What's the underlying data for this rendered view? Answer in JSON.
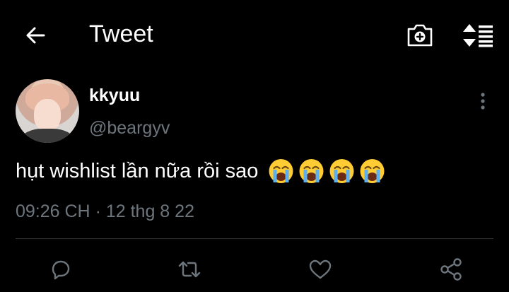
{
  "header": {
    "back_icon": "arrow-left-icon",
    "title": "Tweet",
    "camera_icon": "camera-plus-icon",
    "sort_icon": "sort-icon"
  },
  "tweet": {
    "display_name": "kkyuu",
    "handle": "@beargyv",
    "text": "hụt wishlist lần nữa rồi sao",
    "emojis": [
      "loudly-crying-face",
      "loudly-crying-face",
      "loudly-crying-face",
      "loudly-crying-face"
    ],
    "time": "09:26 CH",
    "separator": "·",
    "date": "12 thg 8 22",
    "more_icon": "more-vertical-icon"
  },
  "actions": {
    "reply_icon": "reply-icon",
    "retweet_icon": "retweet-icon",
    "like_icon": "heart-icon",
    "share_icon": "share-icon"
  },
  "colors": {
    "background": "#000000",
    "text_primary": "#ffffff",
    "text_secondary": "#6e767d",
    "divider": "#2f3336"
  }
}
